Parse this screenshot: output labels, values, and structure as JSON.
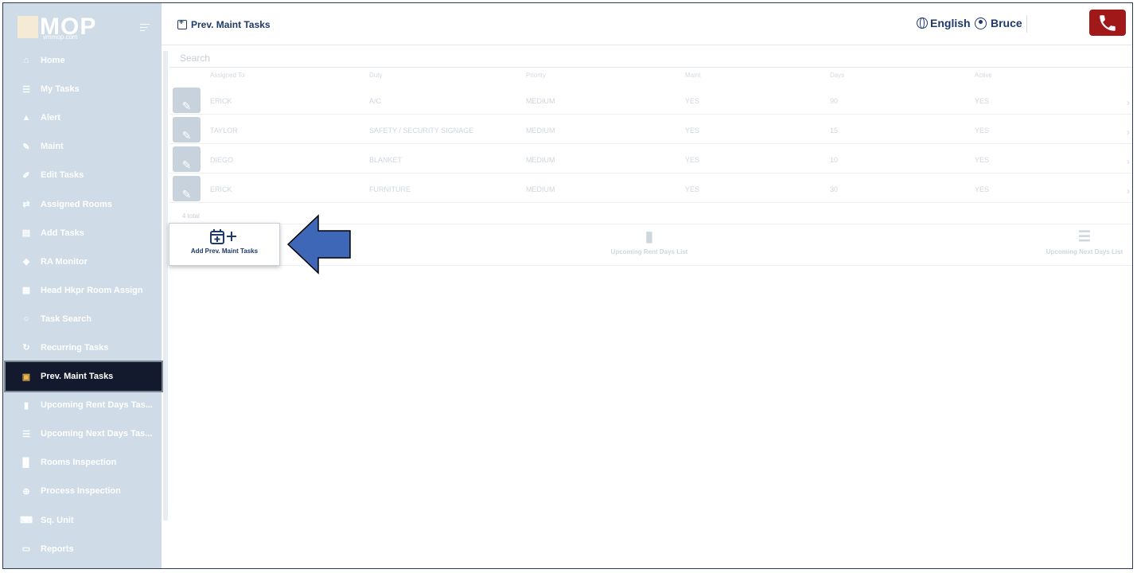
{
  "brand": {
    "name": "MOP",
    "subtitle": "vmmop.com"
  },
  "sidebar": {
    "items": [
      {
        "label": "Home",
        "icon": "home-icon"
      },
      {
        "label": "My Tasks",
        "icon": "list-icon"
      },
      {
        "label": "Alert",
        "icon": "alert-icon"
      },
      {
        "label": "Maint",
        "icon": "wrench-icon"
      },
      {
        "label": "Edit Tasks",
        "icon": "edit-icon"
      },
      {
        "label": "Assigned Rooms",
        "icon": "swap-icon"
      },
      {
        "label": "Add Tasks",
        "icon": "table-icon"
      },
      {
        "label": "RA Monitor",
        "icon": "binoculars-icon"
      },
      {
        "label": "Head Hkpr Room Assign",
        "icon": "building-icon"
      },
      {
        "label": "Task Search",
        "icon": "search-icon"
      },
      {
        "label": "Recurring Tasks",
        "icon": "refresh-icon"
      },
      {
        "label": "Prev. Maint Tasks",
        "icon": "calendar-plus-icon",
        "active": true
      },
      {
        "label": "Upcoming Rent Days Tas...",
        "icon": "clipboard-icon"
      },
      {
        "label": "Upcoming Next Days Tas...",
        "icon": "list-icon"
      },
      {
        "label": "Rooms Inspection",
        "icon": "door-icon"
      },
      {
        "label": "Process Inspection",
        "icon": "magnify-icon"
      },
      {
        "label": "Sq. Unit",
        "icon": "keyboard-icon"
      },
      {
        "label": "Reports",
        "icon": "card-icon"
      }
    ]
  },
  "header": {
    "title": "Prev. Maint Tasks",
    "language": "English",
    "user": "Bruce"
  },
  "search": {
    "placeholder": "Search"
  },
  "table": {
    "columns": [
      "Assigned To",
      "Duty",
      "Priority",
      "Maint",
      "Days",
      "Active"
    ],
    "rows": [
      [
        "ERICK",
        "A/C",
        "MEDIUM",
        "YES",
        "90",
        "YES"
      ],
      [
        "TAYLOR",
        "SAFETY / SECURITY SIGNAGE",
        "MEDIUM",
        "YES",
        "15",
        "YES"
      ],
      [
        "DIEGO",
        "BLANKET",
        "MEDIUM",
        "YES",
        "10",
        "YES"
      ],
      [
        "ERICK",
        "FURNITURE",
        "MEDIUM",
        "YES",
        "30",
        "YES"
      ]
    ],
    "total": "4 total"
  },
  "actions": {
    "add": "Add Prev. Maint Tasks",
    "rent": "Upcoming Rent Days List",
    "next": "Upcoming Next Days List"
  },
  "colors": {
    "sidebar": "#cfdbe6",
    "active": "#141a2e",
    "accent": "#1f3a68",
    "phone": "#a01818",
    "arrow": "#3f67b8"
  }
}
